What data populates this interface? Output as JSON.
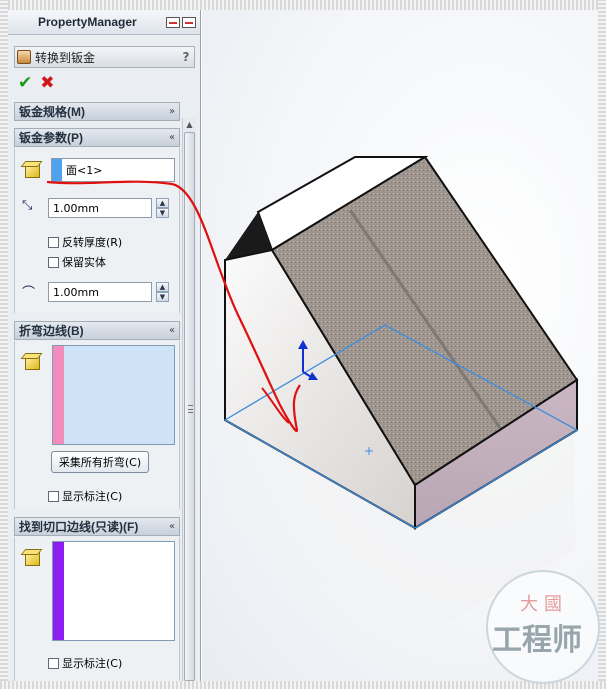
{
  "panel": {
    "title": "PropertyManager",
    "feature_title": "转换到钣金",
    "help": "?",
    "ok_icon": "✔",
    "cancel_icon": "✖"
  },
  "groups": {
    "sheet_metal_gauges": {
      "title": "钣金规格(M)",
      "chevron": "»"
    },
    "sheet_metal_params": {
      "title": "钣金参数(P)",
      "chevron": "«",
      "fixed_face_value": "面<1>",
      "thickness_value": "1.00mm",
      "reverse_thickness_label": "反转厚度(R)",
      "keep_body_label": "保留实体",
      "radius_value": "1.00mm"
    },
    "bend_edges": {
      "title": "折弯边线(B)",
      "chevron": "«",
      "collect_button": "采集所有折弯(C)",
      "show_callouts_label": "显示标注(C)"
    },
    "rip_edges": {
      "title": "找到切口边线(只读)(F)",
      "chevron": "«",
      "show_callouts_label": "显示标注(C)"
    }
  },
  "watermark": {
    "top_text": "大國",
    "main_text": "工程师"
  },
  "colors": {
    "face_swatch": "#4fa3ee",
    "bend_swatch": "#f38bbb",
    "rip_swatch": "#8b1ef0",
    "annotation_red": "#e01010",
    "sketch_blue": "#3d8de0"
  }
}
